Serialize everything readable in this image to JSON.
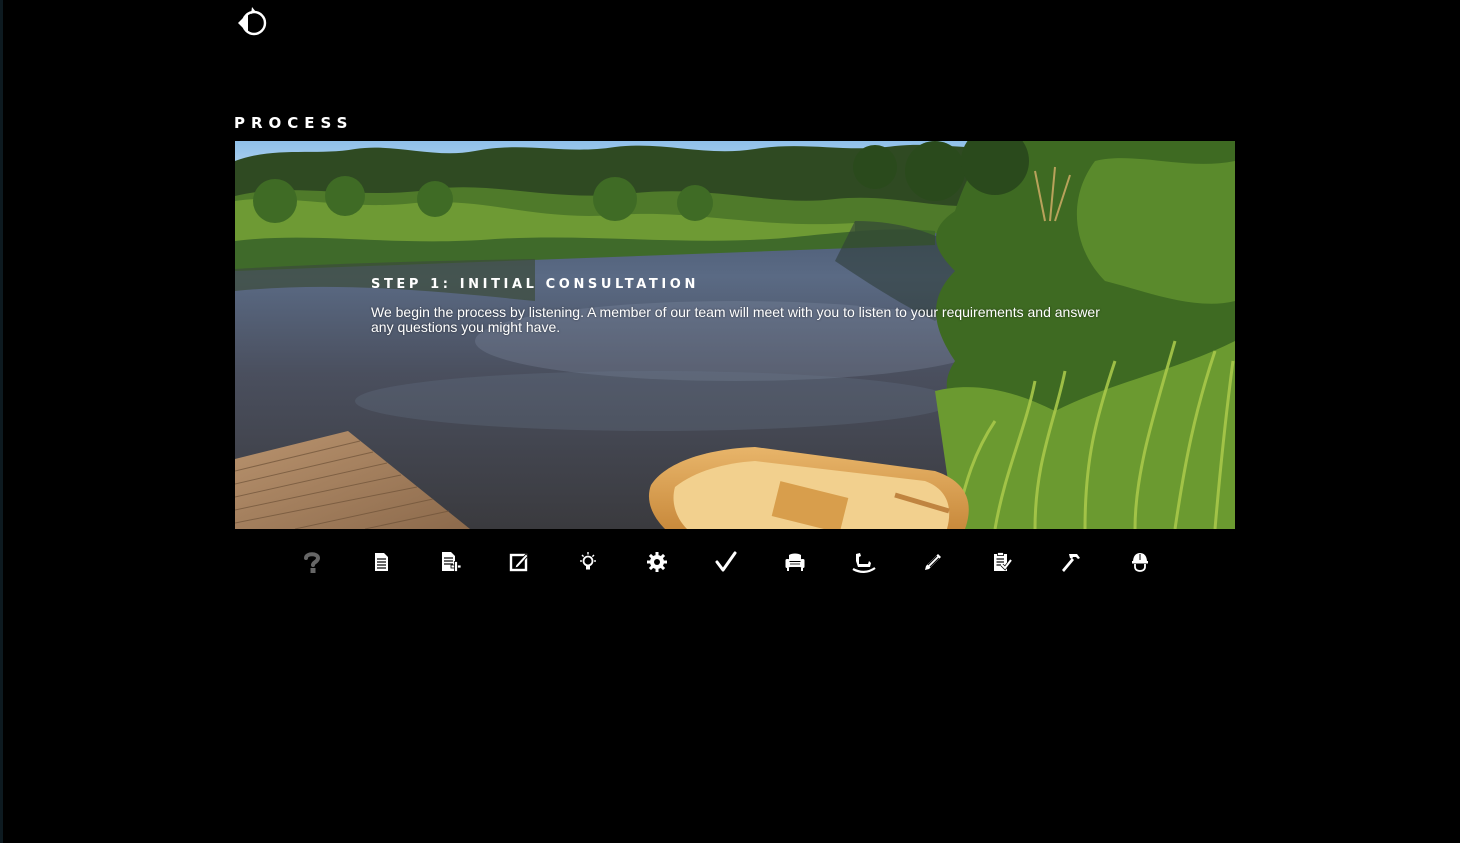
{
  "page": {
    "section_title": "PROCESS"
  },
  "logo": {
    "icon": "circle-arrow-logo-icon"
  },
  "hero": {
    "step_title": "STEP 1: INITIAL CONSULTATION",
    "step_body": "We begin the process by listening. A member of our team will meet with you to listen to your requirements and answer any questions you might have."
  },
  "steps": [
    {
      "icon": "question-mark-icon",
      "active": true
    },
    {
      "icon": "document-icon"
    },
    {
      "icon": "document-add-icon"
    },
    {
      "icon": "edit-icon"
    },
    {
      "icon": "lightbulb-icon"
    },
    {
      "icon": "gear-icon"
    },
    {
      "icon": "checkmark-icon"
    },
    {
      "icon": "armchair-icon"
    },
    {
      "icon": "rocking-horse-icon"
    },
    {
      "icon": "pencil-icon"
    },
    {
      "icon": "clipboard-check-icon"
    },
    {
      "icon": "hammer-icon"
    },
    {
      "icon": "hard-hat-icon"
    }
  ],
  "colors": {
    "background": "#000000",
    "text": "#ffffff",
    "active_icon": "#666666",
    "icon": "#ffffff"
  }
}
